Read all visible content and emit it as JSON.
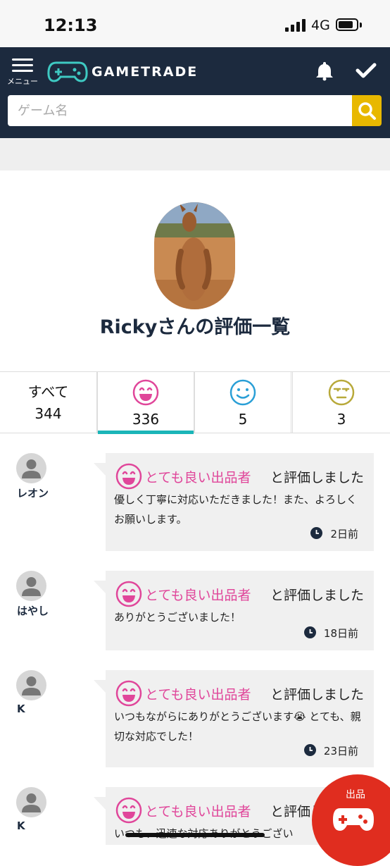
{
  "status_bar": {
    "time": "12:13",
    "network": "4G"
  },
  "header": {
    "menu_label": "メニュー",
    "brand": "GAMETRADE",
    "search_placeholder": "ゲーム名"
  },
  "profile": {
    "title": "Rickyさんの評価一覧"
  },
  "tabs": [
    {
      "label": "すべて",
      "count": "344",
      "active": false
    },
    {
      "icon": "very-good-face-icon",
      "count": "336",
      "active": true,
      "color": "#e0469a"
    },
    {
      "icon": "good-face-icon",
      "count": "5",
      "active": false,
      "color": "#2a9fd6"
    },
    {
      "icon": "bad-face-icon",
      "count": "3",
      "active": false,
      "color": "#b8a93a"
    }
  ],
  "reviews": [
    {
      "name": "レオン",
      "rating": "とても良い出品者",
      "suffix": "と評価しました",
      "comment": "優しく丁寧に対応いただきました！また、よろしくお願いします。",
      "time": "2日前"
    },
    {
      "name": "はやし",
      "rating": "とても良い出品者",
      "suffix": "と評価しました",
      "comment": "ありがとうございました！",
      "time": "18日前"
    },
    {
      "name": "K",
      "rating": "とても良い出品者",
      "suffix": "と評価しました",
      "comment": "いつもながらにありがとうございます😭 とても、親切な対応でした！",
      "time": "23日前"
    },
    {
      "name": "K",
      "rating": "とても良い出品者",
      "suffix": "と評価しました",
      "comment": "いつも、迅速な対応ありがとうござい",
      "time": ""
    }
  ],
  "fab": {
    "label": "出品"
  },
  "colors": {
    "header_bg": "#1c2a3e",
    "accent_teal": "#1bb5b8",
    "search_button": "#e8b800",
    "rating_pink": "#e0469a",
    "fab_red": "#e02d1f"
  }
}
